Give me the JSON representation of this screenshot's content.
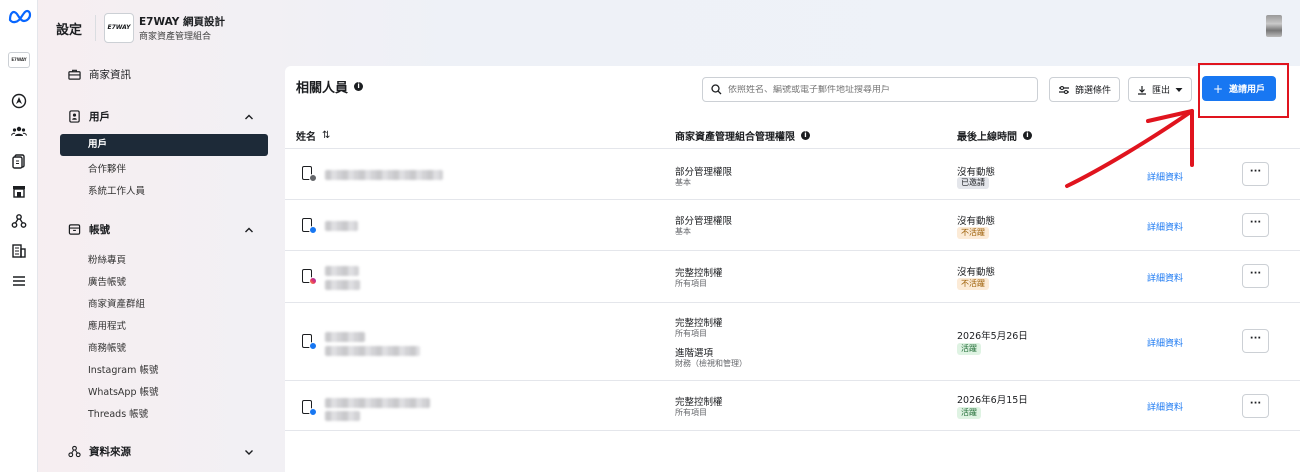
{
  "header": {
    "title": "設定",
    "business_logo_text": "E7WAY",
    "business_name": "E7WAY 網頁設計",
    "business_subtitle": "商家資產管理組合"
  },
  "rail": {
    "logo": "meta-logo",
    "account_badge": "E7WAY",
    "icons": [
      "navigation-icon",
      "people-icon",
      "pages-icon",
      "store-icon",
      "sources-icon",
      "billing-icon",
      "menu-icon"
    ]
  },
  "sidebar": {
    "business_info": "商家資訊",
    "users": {
      "label": "用戶",
      "items": [
        "用戶",
        "合作夥伴",
        "系統工作人員"
      ]
    },
    "accounts": {
      "label": "帳號",
      "items": [
        "粉絲專頁",
        "廣告帳號",
        "商家資產群組",
        "應用程式",
        "商務帳號",
        "Instagram 帳號",
        "WhatsApp 帳號",
        "Threads 帳號"
      ]
    },
    "data_sources": {
      "label": "資料來源"
    }
  },
  "main": {
    "title": "相關人員",
    "search_placeholder": "依照姓名、編號或電子郵件地址搜尋用戶",
    "filter_label": "篩選條件",
    "export_label": "匯出",
    "invite_label": "邀請用戶",
    "columns": {
      "name": "姓名",
      "permission": "商家資產管理組合管理權限",
      "last_login": "最後上線時間"
    },
    "rows": [
      {
        "platform": "meta",
        "perm": "部分管理權限",
        "perm_sub": "基本",
        "activity": "沒有動態",
        "status": "已邀請",
        "status_color": "#e4e6eb",
        "status_text_color": "#1c1e21",
        "details": "詳細資料",
        "more": "···"
      },
      {
        "platform": "facebook",
        "perm": "部分管理權限",
        "perm_sub": "基本",
        "activity": "沒有動態",
        "status": "不活躍",
        "status_color": "#fcebd7",
        "status_text_color": "#9a5b00",
        "details": "詳細資料",
        "more": "···"
      },
      {
        "platform": "instagram",
        "perm": "完整控制權",
        "perm_sub": "所有項目",
        "activity": "沒有動態",
        "status": "不活躍",
        "status_color": "#fcebd7",
        "status_text_color": "#9a5b00",
        "details": "詳細資料",
        "more": "···"
      },
      {
        "platform": "facebook",
        "perm": "完整控制權",
        "perm_sub": "所有項目",
        "perm2": "進階選項",
        "perm2_sub": "財務（檢視和管理）",
        "activity": "2026年5月26日",
        "status": "活躍",
        "status_color": "#dff3e3",
        "status_text_color": "#1e6b33",
        "details": "詳細資料",
        "more": "···"
      },
      {
        "platform": "facebook",
        "perm": "完整控制權",
        "perm_sub": "所有項目",
        "activity": "2026年6月15日",
        "status": "活躍",
        "status_color": "#dff3e3",
        "status_text_color": "#1e6b33",
        "details": "詳細資料",
        "more": "···"
      }
    ]
  },
  "annotation": {
    "color": "#e0141e"
  }
}
